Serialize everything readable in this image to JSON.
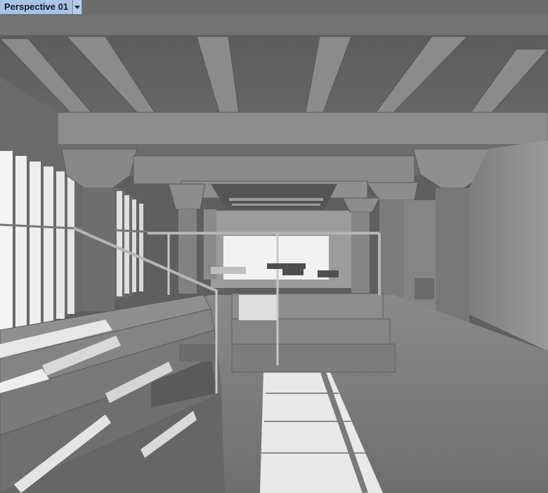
{
  "viewport": {
    "title": "Perspective 01",
    "menu_icon": "chevron-down-icon",
    "render_mode": "grayscale-ambient-occlusion"
  },
  "colors": {
    "tab_bg": "#a9c3e2",
    "tab_text": "#0b1a33",
    "ceiling": "#6a6a6a",
    "floor": "#7a7a7a",
    "window_light": "#f2f2f2"
  }
}
